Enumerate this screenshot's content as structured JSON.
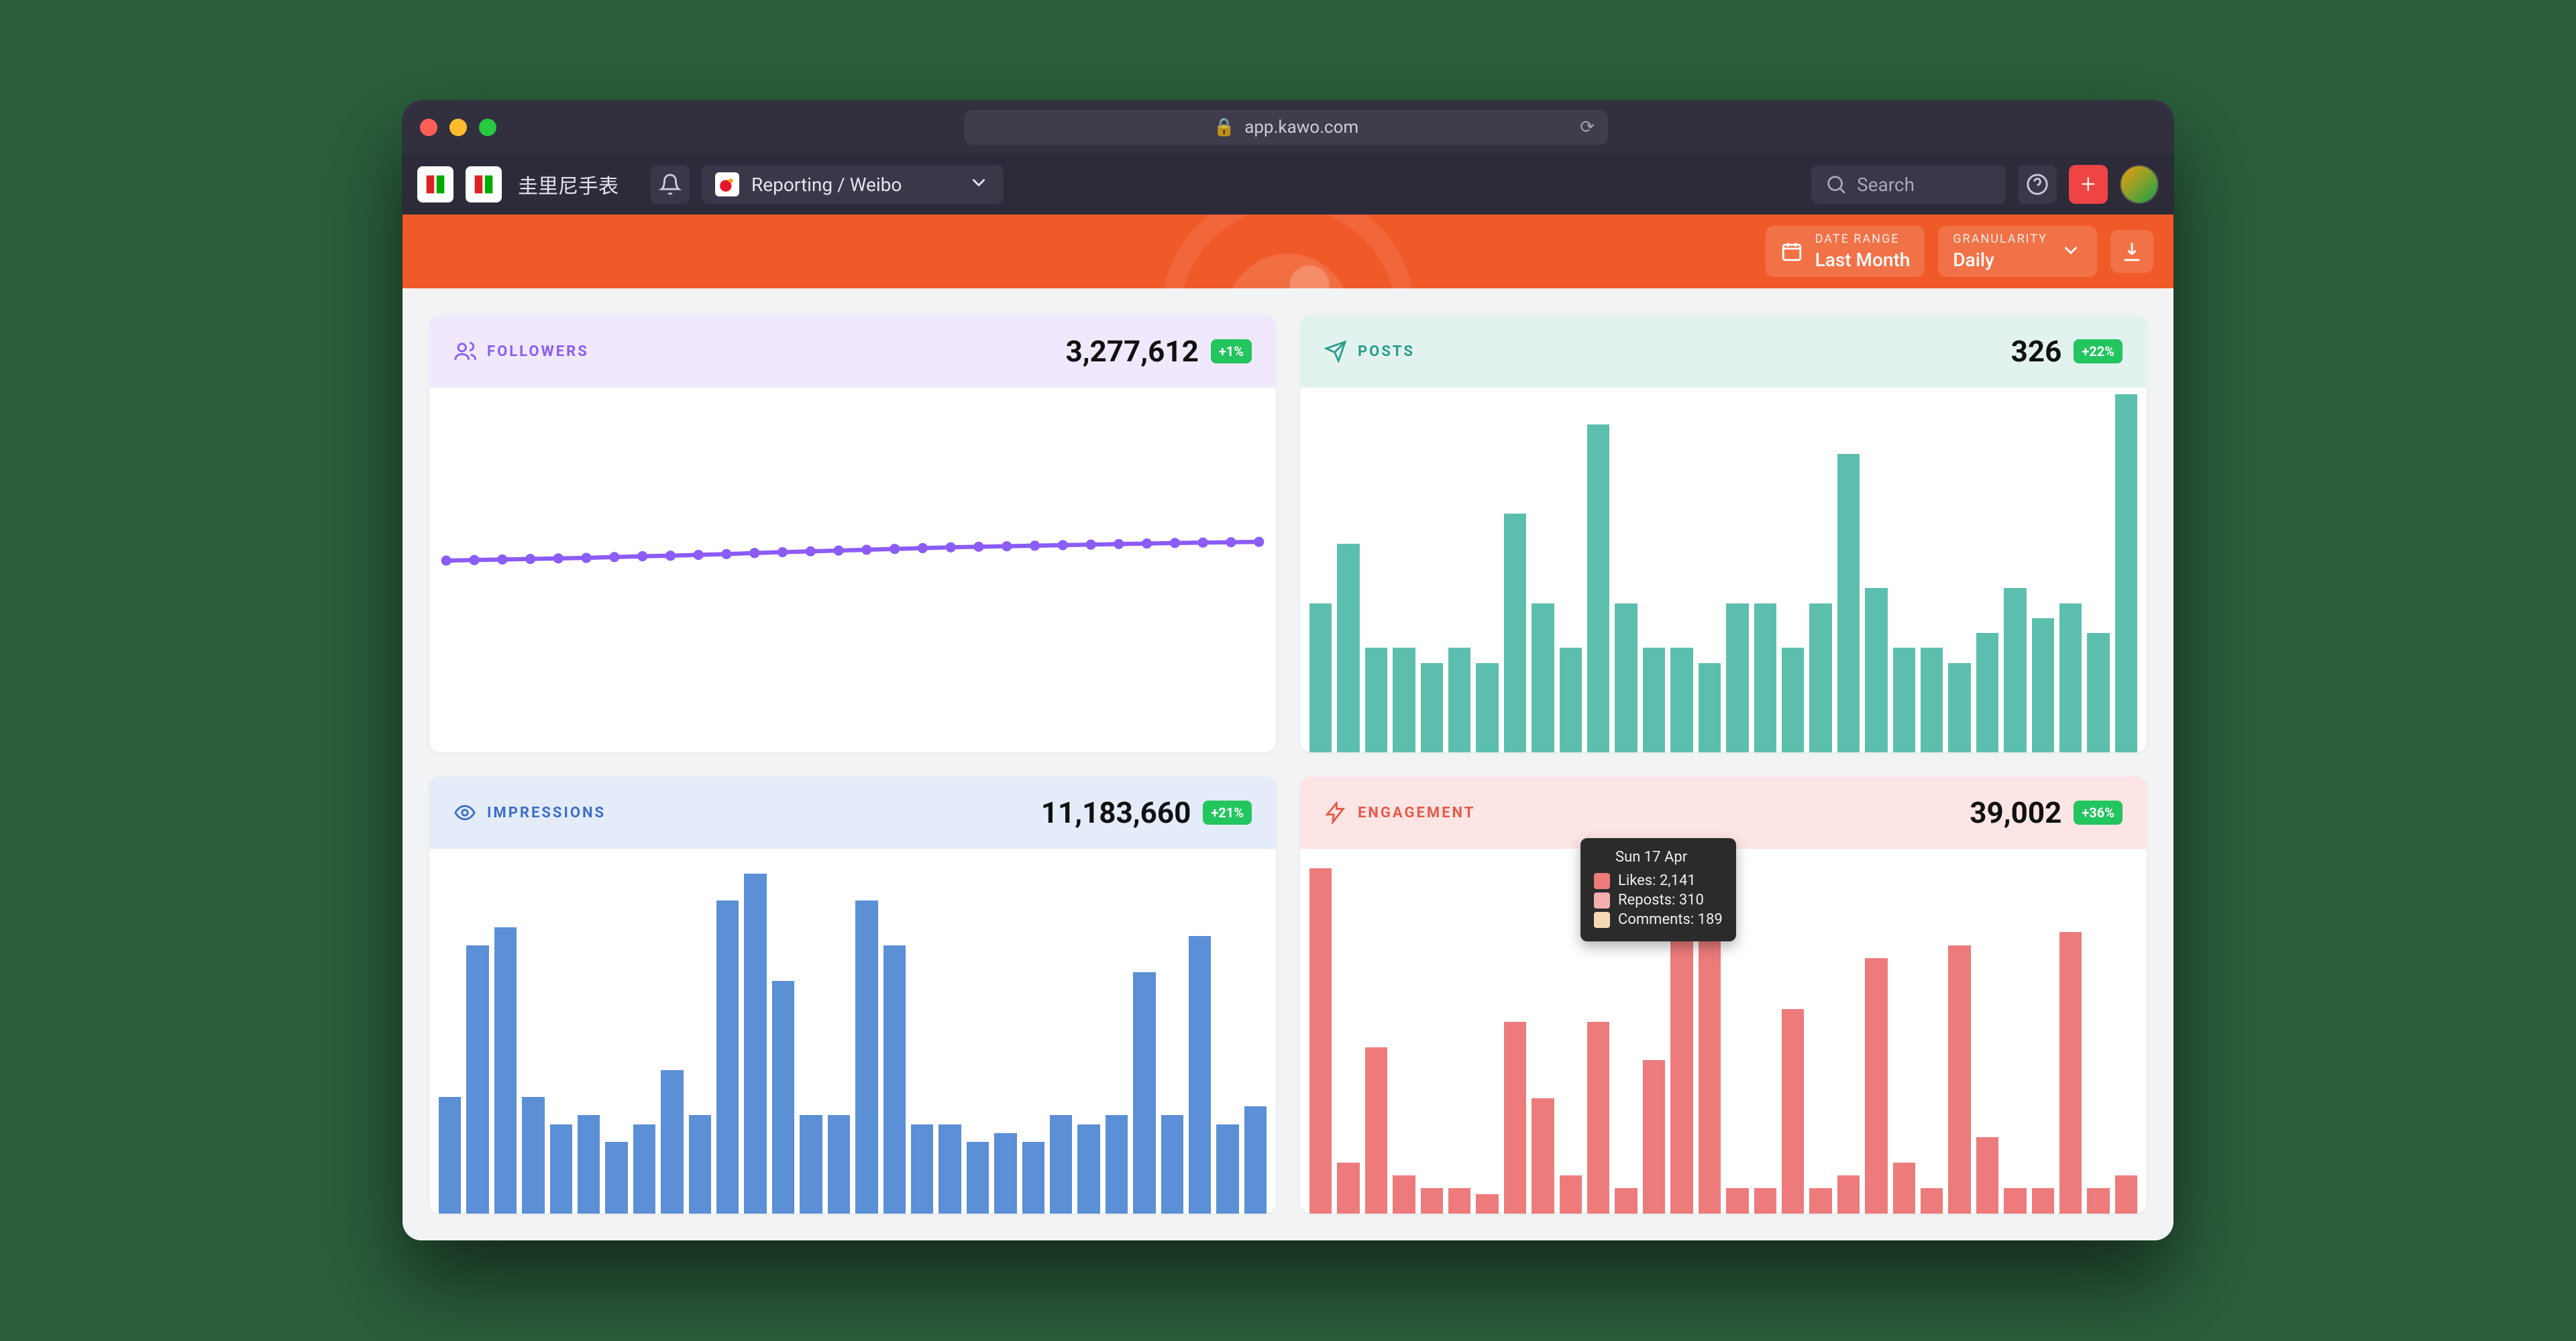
{
  "browser": {
    "url": "app.kawo.com"
  },
  "nav": {
    "brand_label": "圭里尼手表",
    "report_select_label": "Reporting / Weibo",
    "search_placeholder": "Search"
  },
  "filters": {
    "date_range_label": "DATE RANGE",
    "date_range_value": "Last Month",
    "granularity_label": "GRANULARITY",
    "granularity_value": "Daily"
  },
  "cards": {
    "followers": {
      "title": "FOLLOWERS",
      "value": "3,277,612",
      "delta": "+1%"
    },
    "posts": {
      "title": "POSTS",
      "value": "326",
      "delta": "+22%"
    },
    "impressions": {
      "title": "IMPRESSIONS",
      "value": "11,183,660",
      "delta": "+21%"
    },
    "engagement": {
      "title": "ENGAGEMENT",
      "value": "39,002",
      "delta": "+36%"
    }
  },
  "tooltip": {
    "date": "Sun 17 Apr",
    "rows": [
      {
        "label": "Likes: 2,141",
        "color": "#ed7b7b"
      },
      {
        "label": "Reposts: 310",
        "color": "#f4aeae"
      },
      {
        "label": "Comments: 189",
        "color": "#f3d9b6"
      }
    ]
  },
  "colors": {
    "purple": "#8b5cf6",
    "teal": "#5cbfad",
    "blue": "#5b8fd6",
    "salmon": "#ed7b7b",
    "orange": "#f05a28",
    "green": "#22c55e"
  },
  "chart_data": [
    {
      "id": "followers",
      "type": "line",
      "title": "Followers (daily)",
      "x": [
        1,
        2,
        3,
        4,
        5,
        6,
        7,
        8,
        9,
        10,
        11,
        12,
        13,
        14,
        15,
        16,
        17,
        18,
        19,
        20,
        21,
        22,
        23,
        24,
        25,
        26,
        27,
        28,
        29,
        30
      ],
      "values": [
        3243000,
        3244000,
        3245000,
        3246000,
        3247000,
        3248000,
        3249500,
        3251000,
        3252000,
        3253500,
        3255000,
        3257000,
        3258500,
        3260000,
        3261500,
        3263000,
        3264500,
        3266000,
        3267500,
        3268500,
        3269500,
        3270500,
        3271500,
        3272500,
        3273500,
        3274500,
        3275500,
        3276200,
        3276900,
        3277612
      ],
      "ylim": [
        3000000,
        3500000
      ]
    },
    {
      "id": "posts",
      "type": "bar",
      "title": "Posts (daily)",
      "x": [
        1,
        2,
        3,
        4,
        5,
        6,
        7,
        8,
        9,
        10,
        11,
        12,
        13,
        14,
        15,
        16,
        17,
        18,
        19,
        20,
        21,
        22,
        23,
        24,
        25,
        26,
        27,
        28,
        29,
        30
      ],
      "values": [
        10,
        14,
        7,
        7,
        6,
        7,
        6,
        16,
        10,
        7,
        22,
        10,
        7,
        7,
        6,
        10,
        10,
        7,
        10,
        20,
        11,
        7,
        7,
        6,
        8,
        11,
        9,
        10,
        8,
        24
      ],
      "ylim": [
        0,
        24
      ]
    },
    {
      "id": "impressions",
      "type": "bar",
      "title": "Impressions (daily)",
      "x": [
        1,
        2,
        3,
        4,
        5,
        6,
        7,
        8,
        9,
        10,
        11,
        12,
        13,
        14,
        15,
        16,
        17,
        18,
        19,
        20,
        21,
        22,
        23,
        24,
        25,
        26,
        27,
        28,
        29,
        30
      ],
      "values": [
        260000,
        600000,
        640000,
        260000,
        200000,
        220000,
        160000,
        200000,
        320000,
        220000,
        700000,
        760000,
        520000,
        220000,
        220000,
        700000,
        600000,
        200000,
        200000,
        160000,
        180000,
        160000,
        220000,
        200000,
        220000,
        540000,
        220000,
        620000,
        200000,
        240000
      ],
      "ylim": [
        0,
        800000
      ]
    },
    {
      "id": "engagement",
      "type": "bar",
      "title": "Engagement (daily)",
      "x": [
        1,
        2,
        3,
        4,
        5,
        6,
        7,
        8,
        9,
        10,
        11,
        12,
        13,
        14,
        15,
        16,
        17,
        18,
        19,
        20,
        21,
        22,
        23,
        24,
        25,
        26,
        27,
        28,
        29,
        30
      ],
      "values": [
        2700,
        400,
        1300,
        300,
        200,
        200,
        150,
        1500,
        900,
        300,
        1500,
        200,
        1200,
        2400,
        2600,
        200,
        200,
        1600,
        200,
        300,
        2000,
        400,
        200,
        2100,
        600,
        200,
        200,
        2200,
        200,
        300
      ],
      "ylim": [
        0,
        2800
      ],
      "hover_index": 14,
      "hover_breakdown": {
        "date": "Sun 17 Apr",
        "likes": 2141,
        "reposts": 310,
        "comments": 189
      }
    }
  ]
}
